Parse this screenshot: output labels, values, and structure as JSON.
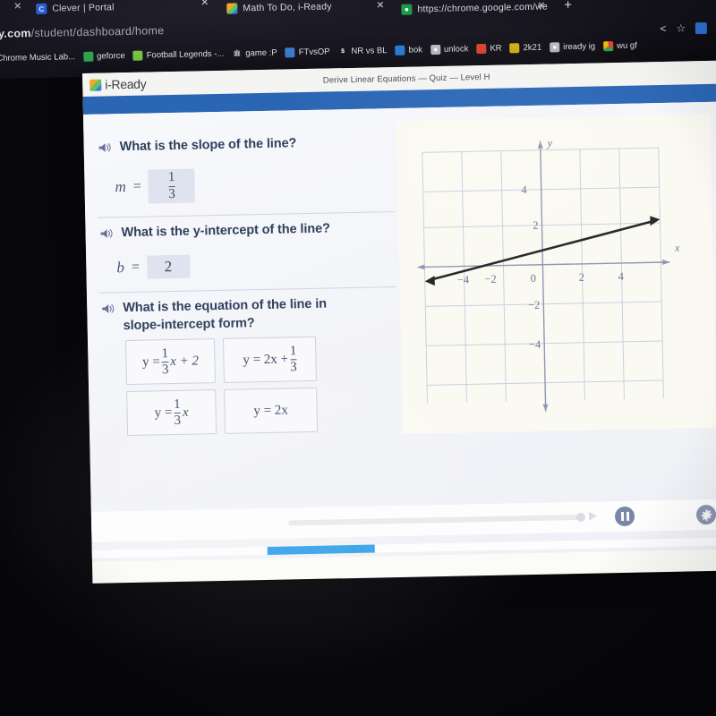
{
  "browser": {
    "tabs": [
      {
        "title": "Clever | Portal",
        "favicon": "clever-icon"
      },
      {
        "title": "Math To Do, i-Ready",
        "favicon": "iready-cube-icon"
      },
      {
        "title": "https://chrome.google.com/we",
        "favicon": "chrome-webstore-icon"
      }
    ],
    "new_tab_label": "+",
    "close_label": "×",
    "url": {
      "domain": "ady.com",
      "path": "/student/dashboard/home"
    },
    "bookmarks": [
      {
        "label": "Chrome Music Lab...",
        "icon": "music-lab-icon"
      },
      {
        "label": "geforce",
        "icon": "geforce-icon"
      },
      {
        "label": "Football Legends -...",
        "icon": "football-icon"
      },
      {
        "label": "game :P",
        "icon": "bank-icon"
      },
      {
        "label": "FTvsOP",
        "icon": "ftvsop-icon"
      },
      {
        "label": "NR vs BL",
        "icon": "nrvsbl-icon"
      },
      {
        "label": "bok",
        "icon": "doc-icon"
      },
      {
        "label": "unlock",
        "icon": "unlock-icon"
      },
      {
        "label": "KR",
        "icon": "youtube-icon"
      },
      {
        "label": "2k21",
        "icon": "game-icon"
      },
      {
        "label": "iready ig",
        "icon": "iready-ig-icon"
      },
      {
        "label": "wu gf",
        "icon": "chrome-icon"
      }
    ],
    "toolbar_icons": [
      "share-icon",
      "star-bookmark-icon",
      "extension-icon",
      "profile-icon"
    ]
  },
  "app": {
    "logo_text": "i-Ready",
    "quiz_title": "Derive Linear Equations — Quiz — Level H",
    "accent_blue": "#2b66b5"
  },
  "questions": [
    {
      "id": "slope",
      "speaker_icon": "speaker-icon",
      "text": "What is the slope of the line?",
      "var_label": "m",
      "equals": "=",
      "answer_type": "fraction",
      "answer_numerator": "1",
      "answer_denominator": "3"
    },
    {
      "id": "y-intercept",
      "speaker_icon": "speaker-icon",
      "text": "What is the y-intercept of the line?",
      "var_label": "b",
      "equals": "=",
      "answer_type": "value",
      "answer_value": "2"
    },
    {
      "id": "equation",
      "speaker_icon": "speaker-icon",
      "text_line1": "What is the equation of the line in",
      "text_line2": "slope-intercept form?"
    }
  ],
  "choices": [
    {
      "id": "choice-a",
      "lhs": "y =",
      "frac_num": "1",
      "frac_den": "3",
      "tail": "x + 2",
      "form": "frac-lead"
    },
    {
      "id": "choice-b",
      "lhs": "y = 2x +",
      "frac_num": "1",
      "frac_den": "3",
      "tail": "",
      "form": "frac-trail"
    },
    {
      "id": "choice-c",
      "lhs": "y =",
      "frac_num": "1",
      "frac_den": "3",
      "tail": "x",
      "form": "frac-lead"
    },
    {
      "id": "choice-d",
      "lhs": "y = 2x",
      "frac_num": "",
      "frac_den": "",
      "tail": "",
      "form": "plain"
    }
  ],
  "graph": {
    "x_label": "x",
    "y_label": "y",
    "x_ticks": [
      "-4",
      "-2",
      "0",
      "2",
      "4"
    ],
    "y_ticks": [
      "4",
      "2",
      "-2",
      "-4"
    ],
    "line_slope": "1/3",
    "line_intercept": "2",
    "grid": "on"
  },
  "chart_data": {
    "type": "line",
    "title": "",
    "xlabel": "x",
    "ylabel": "y",
    "xlim": [
      -6,
      6
    ],
    "ylim": [
      -6,
      6
    ],
    "x_ticks": [
      -4,
      -2,
      0,
      2,
      4
    ],
    "y_ticks": [
      4,
      2,
      -2,
      -4
    ],
    "grid": true,
    "series": [
      {
        "name": "y = (1/3)x + 2",
        "slope": 0.3333,
        "intercept": 2,
        "x": [
          -5.5,
          5.5
        ],
        "values": [
          0.1667,
          3.8333
        ],
        "arrows": "both"
      }
    ]
  },
  "player": {
    "play_icon": "play-icon",
    "pause_icon": "pause-icon",
    "settings_icon": "gear-icon",
    "progress_percent": "17"
  }
}
